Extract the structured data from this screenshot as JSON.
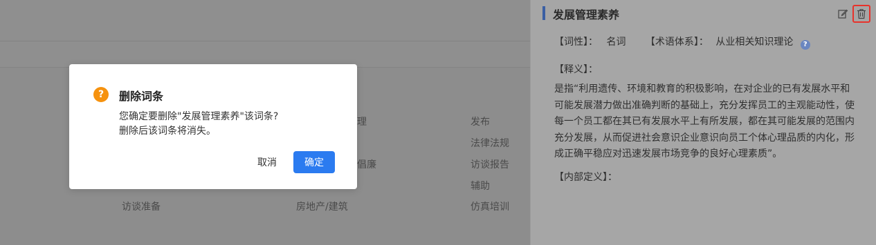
{
  "background": {
    "cells": [
      {
        "text": "访谈准备"
      },
      {
        "text": "房地产/建筑"
      },
      {
        "text": "仿真培训"
      },
      {
        "text": "理"
      },
      {
        "text": "倡廉"
      },
      {
        "text": "发布"
      },
      {
        "text": "法律法规"
      },
      {
        "text": "访谈报告"
      },
      {
        "text": "辅助"
      }
    ]
  },
  "drawer": {
    "title": "发展管理素养",
    "part_of_speech_label": "【词性】：",
    "part_of_speech_value": "名词",
    "term_system_label": "【术语体系】：",
    "term_system_value": "从业相关知识理论",
    "definition_label": "【释义】：",
    "definition_text": "是指“利用遗传、环境和教育的积极影响，在对企业的已有发展水平和可能发展潜力做出准确判断的基础上，充分发挥员工的主观能动性，使每一个员工都在其已有发展水平上有所发展，都在其可能发展的范围内充分发展，从而促进社会意识企业意识向员工个体心理品质的内化，形成正确平稳应对迅速发展市场竞争的良好心理素质”。",
    "internal_def_label": "【内部定义】：",
    "icons": {
      "edit": "edit-icon",
      "delete": "trash-icon",
      "help": "question-circle-icon"
    },
    "accent_color": "#3a5fa3",
    "highlight_color": "#e8322a"
  },
  "modal": {
    "title": "删除词条",
    "message_line1": "您确定要删除\"发展管理素养\"该词条?",
    "message_line2": "删除后该词条将消失。",
    "cancel_label": "取消",
    "confirm_label": "确定",
    "icon": "question-icon",
    "icon_glyph": "?",
    "icon_color": "#f6920e",
    "confirm_color": "#2b7bf0"
  }
}
